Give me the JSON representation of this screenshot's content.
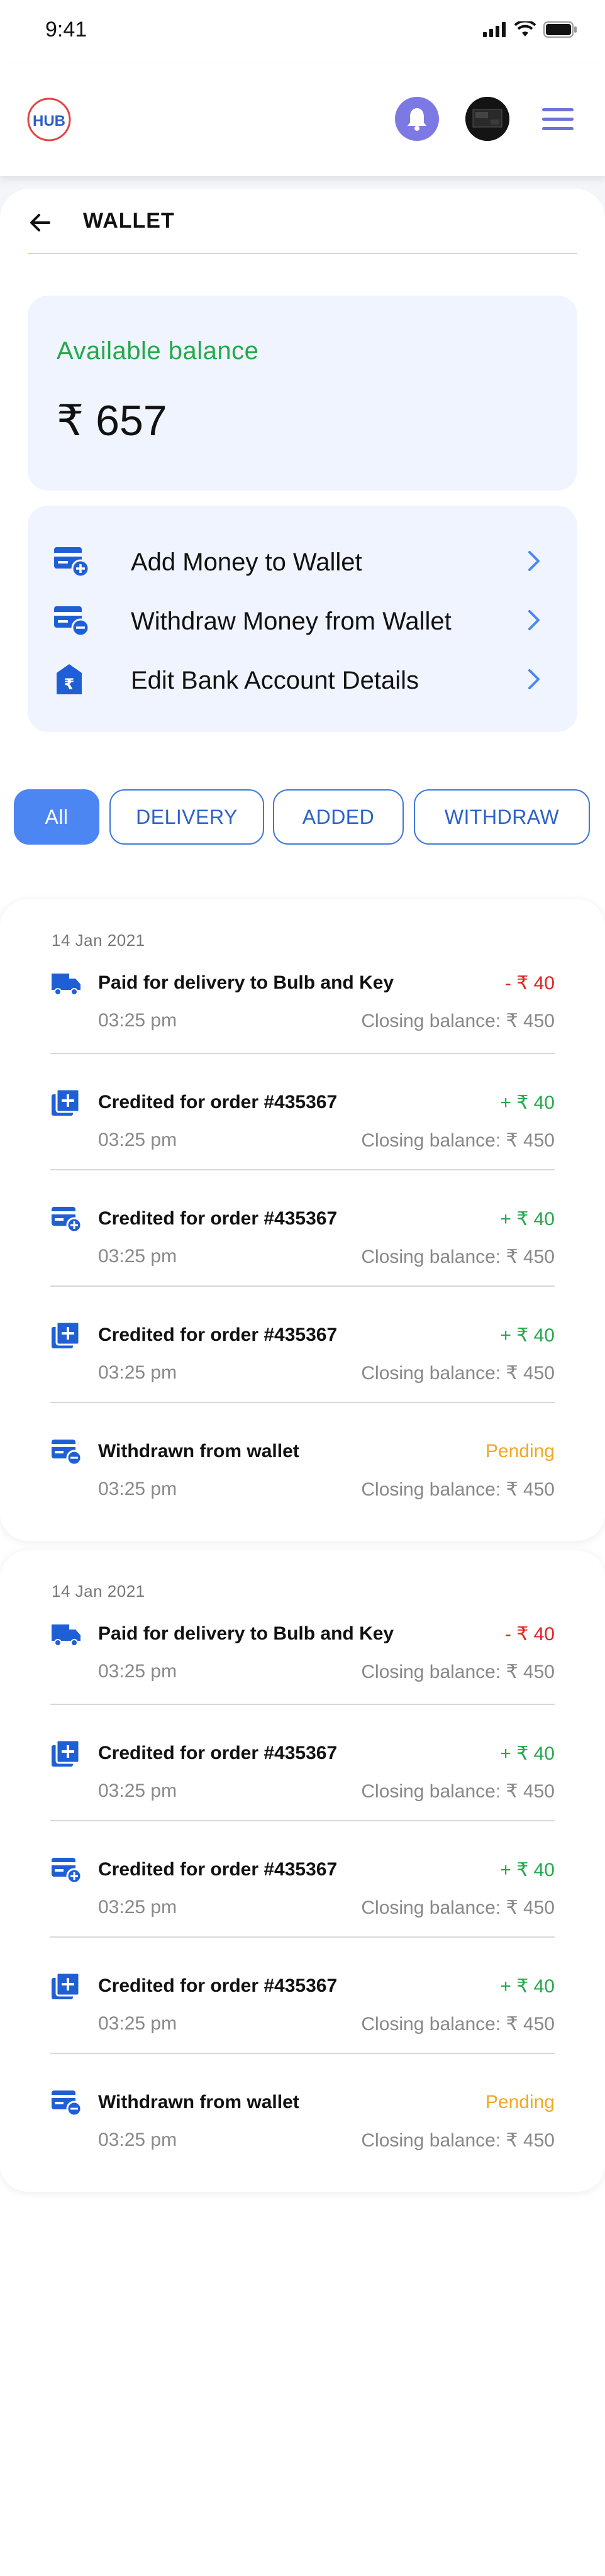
{
  "status_bar": {
    "time": "9:41"
  },
  "header": {
    "logo_text": "HUB"
  },
  "page": {
    "title": "WALLET"
  },
  "balance": {
    "label": "Available balance",
    "value": "₹ 657"
  },
  "actions": [
    {
      "label": "Add Money to Wallet"
    },
    {
      "label": "Withdraw Money from Wallet"
    },
    {
      "label": "Edit Bank Account Details"
    }
  ],
  "filters": [
    {
      "label": "All",
      "active": true
    },
    {
      "label": "DELIVERY",
      "active": false
    },
    {
      "label": "ADDED",
      "active": false
    },
    {
      "label": "WITHDRAW",
      "active": false
    }
  ],
  "groups": [
    {
      "date": "14 Jan 2021",
      "transactions": [
        {
          "icon": "delivery-truck-icon",
          "title": "Paid for delivery to Bulb and Key",
          "amount": "- ₹ 40",
          "type": "debit",
          "time": "03:25 pm",
          "closing": "Closing balance: ₹ 450"
        },
        {
          "icon": "credit-plus-icon",
          "title": "Credited for order #435367",
          "amount": "+ ₹ 40",
          "type": "credit",
          "time": "03:25 pm",
          "closing": "Closing balance: ₹ 450"
        },
        {
          "icon": "wallet-add-icon",
          "title": "Credited for order #435367",
          "amount": "+ ₹ 40",
          "type": "credit",
          "time": "03:25 pm",
          "closing": "Closing balance: ₹ 450"
        },
        {
          "icon": "credit-plus-icon",
          "title": "Credited for order #435367",
          "amount": "+ ₹ 40",
          "type": "credit",
          "time": "03:25 pm",
          "closing": "Closing balance: ₹ 450"
        },
        {
          "icon": "wallet-withdraw-icon",
          "title": "Withdrawn from wallet",
          "amount": "Pending",
          "type": "pending",
          "time": "03:25 pm",
          "closing": "Closing balance: ₹ 450"
        }
      ]
    },
    {
      "date": "14 Jan 2021",
      "transactions": [
        {
          "icon": "delivery-truck-icon",
          "title": "Paid for delivery to Bulb and Key",
          "amount": "- ₹ 40",
          "type": "debit",
          "time": "03:25 pm",
          "closing": "Closing balance: ₹ 450"
        },
        {
          "icon": "credit-plus-icon",
          "title": "Credited for order #435367",
          "amount": "+ ₹ 40",
          "type": "credit",
          "time": "03:25 pm",
          "closing": "Closing balance: ₹ 450"
        },
        {
          "icon": "wallet-add-icon",
          "title": "Credited for order #435367",
          "amount": "+ ₹ 40",
          "type": "credit",
          "time": "03:25 pm",
          "closing": "Closing balance: ₹ 450"
        },
        {
          "icon": "credit-plus-icon",
          "title": "Credited for order #435367",
          "amount": "+ ₹ 40",
          "type": "credit",
          "time": "03:25 pm",
          "closing": "Closing balance: ₹ 450"
        },
        {
          "icon": "wallet-withdraw-icon",
          "title": "Withdrawn from wallet",
          "amount": "Pending",
          "type": "pending",
          "time": "03:25 pm",
          "closing": "Closing balance: ₹ 450"
        }
      ]
    }
  ],
  "colors": {
    "accent": "#4c86f2",
    "icon_blue": "#1f5fd6",
    "credit": "#23a94c",
    "debit": "#e02323",
    "pending": "#f2a722",
    "bell": "#7c79e4"
  }
}
